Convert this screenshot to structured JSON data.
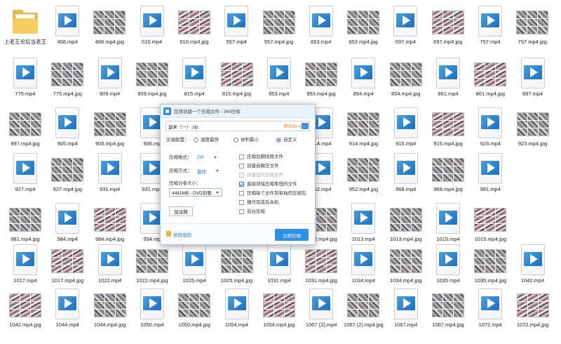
{
  "folder": {
    "label": "上老王论坛当老王"
  },
  "files": [
    [
      "468.mp4",
      "468.mp4.jpg",
      "510.mp4",
      "510.mp4.jpg",
      "557.mp4",
      "557.mp4.jpg",
      "653.mp4",
      "653.mp4.jpg",
      "697.mp4",
      "697.mp4.jpg",
      "757.mp4",
      "757.mp4.jpg"
    ],
    [
      "775.mp4",
      "775.mp4.jpg",
      "809.mp4",
      "809.mp4.jpg",
      "815.mp4",
      "815.mp4.jpg",
      "853.mp4",
      "853.mp4.jpg",
      "854.mp4",
      "854.mp4.jpg",
      "861.mp4",
      "861.mp4.jpg",
      "897.mp4"
    ],
    [
      "897.mp4.jpg",
      "905.mp4",
      "905.mp4.jpg",
      "906.mp",
      "",
      "",
      "",
      "914.mp4",
      "914.mp4.jpg",
      "915.mp4",
      "915.mp4.jpg",
      "923.mp4",
      "923.mp4.jpg"
    ],
    [
      "927.mp4",
      "927.mp4.jpg",
      "931.mp4",
      "931.mp4",
      "",
      "",
      "",
      "952.mp4",
      "952.mp4.jpg",
      "968.mp4",
      "968.mp4.jpg",
      "981.mp4"
    ],
    [
      "981.mp4.jpg",
      "984.mp4",
      "984.mp4.jpg",
      "994.mp",
      "",
      "",
      "",
      "1012.mp4.jpg",
      "1013.mp4",
      "1013.mp4.jpg",
      "1015.mp4",
      "1015.mp4.jpg"
    ],
    [
      "1017.mp4",
      "1017.mp4.jpg",
      "1022.mp4",
      "1022.mp4.jpg",
      "1025.mp4",
      "1025.mp4.jpg",
      "1031.mp4",
      "1031.mp4.jpg",
      "1034.mp4",
      "1034.mp4.jpg",
      "1035.mp4",
      "1035.mp4.jpg",
      "1042.mp4"
    ],
    [
      "1042.mp4.jpg",
      "1044.mp4",
      "1044.mp4.jpg",
      "1050.mp4",
      "1050.mp4.jpg",
      "1054.mp4",
      "1054.mp4.jpg",
      "1067 (2).mp4",
      "1067 (2).mp4.jpg",
      "1067.mp4",
      "1067.mp4.jpg",
      "1072.mp4",
      "1072.mp4.jpg"
    ]
  ],
  "dialog": {
    "title": "您将创建一个压缩文件 - 360压缩",
    "archive_name": "益米（一）.zip",
    "remaining": "剩余63.4GB",
    "profile_label": "压缩配置：",
    "profile_fast": "速度最快",
    "profile_small": "体积最小",
    "profile_custom": "自定义",
    "format_label": "压缩格式：",
    "format_value": "ZIP",
    "method_label": "压缩方式：",
    "method_value": "最快",
    "volume_label": "压缩分卷大小：",
    "volume_value": "4481MB - DVD刻录",
    "password_button": "加注释",
    "opt_delete": "压缩后删除原文件",
    "opt_selfextract": "创建自解压文件",
    "opt_solid": "创建固实压缩文件",
    "opt_store": "直接存储压缩率低的文件",
    "opt_each": "压缩每个文件到单独的压缩包",
    "opt_shutdown": "操作完成后关机",
    "opt_background": "后台压缩",
    "edit_password": "修改密码",
    "start_button": "立即压缩"
  }
}
